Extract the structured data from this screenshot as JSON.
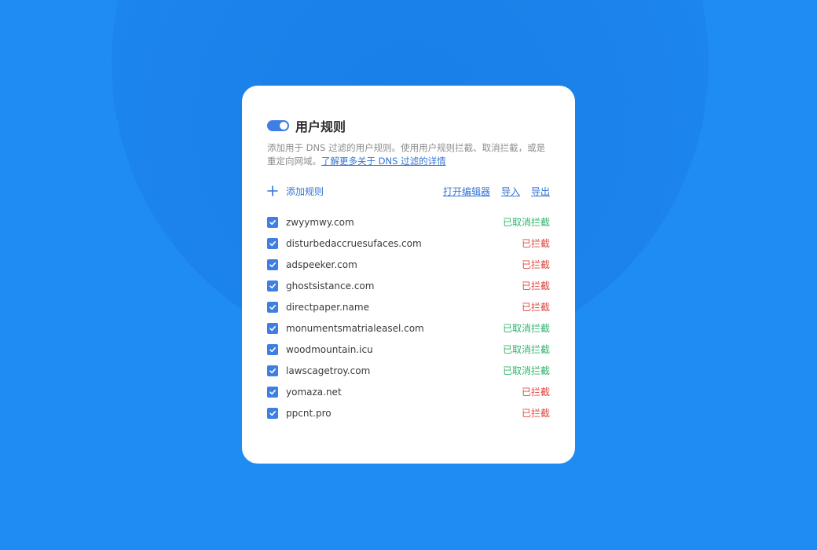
{
  "header": {
    "title": "用户规则",
    "description": "添加用于 DNS 过滤的用户规则。使用用户规则拦截、取消拦截，或是重定向网域。",
    "learn_more": "了解更多关于 DNS 过滤的详情"
  },
  "actions": {
    "add_rule": "添加规则",
    "open_editor": "打开编辑器",
    "import": "导入",
    "export": "导出"
  },
  "rules": [
    {
      "domain": "zwyymwy.com",
      "status": "已取消拦截",
      "type": "unblocked",
      "checked": true
    },
    {
      "domain": "disturbedaccruesufaces.com",
      "status": "已拦截",
      "type": "blocked",
      "checked": true
    },
    {
      "domain": "adspeeker.com",
      "status": "已拦截",
      "type": "blocked",
      "checked": true
    },
    {
      "domain": "ghostsistance.com",
      "status": "已拦截",
      "type": "blocked",
      "checked": true
    },
    {
      "domain": "directpaper.name",
      "status": "已拦截",
      "type": "blocked",
      "checked": true
    },
    {
      "domain": "monumentsmatrialeasel.com",
      "status": "已取消拦截",
      "type": "unblocked",
      "checked": true
    },
    {
      "domain": "woodmountain.icu",
      "status": "已取消拦截",
      "type": "unblocked",
      "checked": true
    },
    {
      "domain": "lawscagetroy.com",
      "status": "已取消拦截",
      "type": "unblocked",
      "checked": true
    },
    {
      "domain": "yomaza.net",
      "status": "已拦截",
      "type": "blocked",
      "checked": true
    },
    {
      "domain": "ppcnt.pro",
      "status": "已拦截",
      "type": "blocked",
      "checked": true
    }
  ],
  "colors": {
    "background": "#1f8cf3",
    "accent": "#3474d6",
    "blocked": "#e0453e",
    "unblocked": "#2fb36c"
  }
}
